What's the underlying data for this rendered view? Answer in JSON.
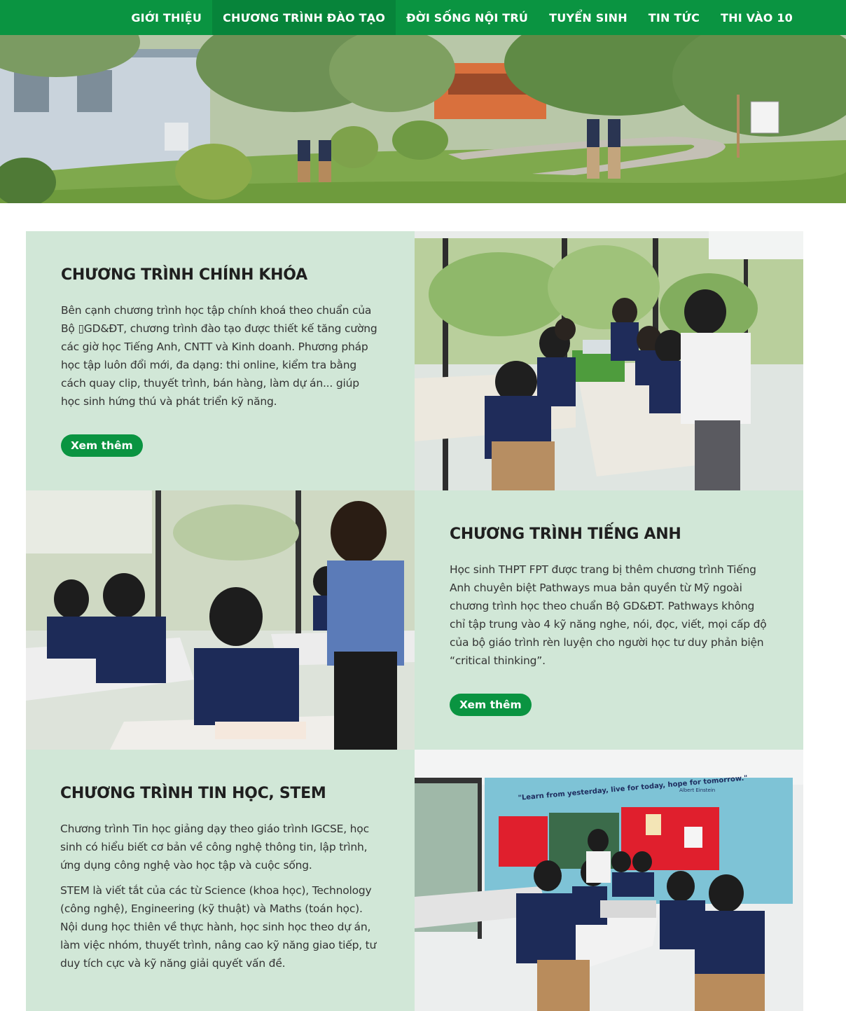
{
  "nav": {
    "items": [
      {
        "label": "GIỚI THIỆU",
        "active": false
      },
      {
        "label": "CHƯƠNG TRÌNH ĐÀO TẠO",
        "active": true
      },
      {
        "label": "ĐỜI SỐNG NỘI TRÚ",
        "active": false
      },
      {
        "label": "TUYỂN SINH",
        "active": false
      },
      {
        "label": "TIN TỨC",
        "active": false
      },
      {
        "label": "THI VÀO 10",
        "active": false
      }
    ]
  },
  "colors": {
    "brand_green": "#0a9441",
    "panel_bg": "#d1e7d7"
  },
  "sections": [
    {
      "title": "CHƯƠNG TRÌNH CHÍNH KHÓA",
      "paragraphs": [
        "Bên cạnh chương trình học tập chính khoá theo chuẩn của Bộ ▯GD&ĐT, chương trình đào tạo được thiết kế tăng cường các giờ học Tiếng Anh, CNTT và Kinh doanh. Phương pháp học tập luôn đổi mới, đa dạng: thi online, kiểm tra bằng cách quay clip, thuyết trình, bán hàng, làm dự án... giúp học sinh hứng thú và phát triển kỹ năng."
      ],
      "button": "Xem thêm"
    },
    {
      "title": "CHƯƠNG TRÌNH TIẾNG ANH",
      "paragraphs": [
        "Học sinh THPT FPT được trang bị thêm chương trình Tiếng Anh chuyên biệt Pathways mua bản quyền từ Mỹ ngoài chương trình học theo chuẩn Bộ GD&ĐT. Pathways không chỉ tập trung vào 4 kỹ năng nghe, nói, đọc, viết, mọi cấp độ của bộ giáo trình rèn luyện cho người học tư duy phản biện “critical thinking”."
      ],
      "button": "Xem thêm"
    },
    {
      "title": "CHƯƠNG TRÌNH TIN HỌC, STEM",
      "paragraphs": [
        "Chương trình Tin học giảng dạy theo giáo trình IGCSE, học sinh có hiểu biết cơ bản về công nghệ thông tin, lập trình, ứng dụng công nghệ vào học tập và cuộc sống.",
        "STEM là viết tắt của các từ Science (khoa học), Technology (công nghệ), Engineering (kỹ thuật) và Maths (toán học). Nội dung học thiên về thực hành, học sinh học theo dự án, làm việc nhóm, thuyết trình, nâng cao kỹ năng giao tiếp, tư duy tích cực và kỹ năng giải quyết vấn đề."
      ]
    }
  ],
  "classroom_quote": {
    "text": "\"Learn from yesterday, live for today, hope for tomorrow.\"",
    "author": "Albert Einstein"
  }
}
